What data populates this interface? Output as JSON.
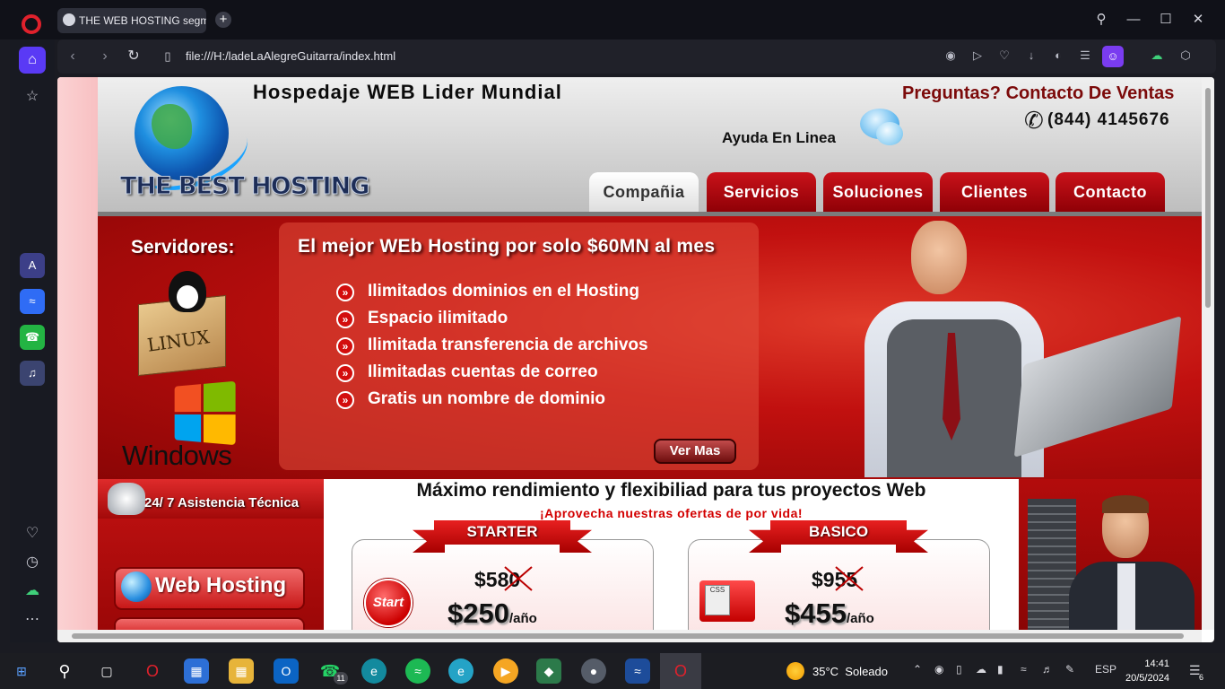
{
  "browser": {
    "tab_title": "THE WEB HOSTING segmé",
    "url": "file:///H:/ladeLaAlegreGuitarra/index.html",
    "colors": {
      "accent": "#7a3cf0",
      "chrome": "#101118"
    }
  },
  "header": {
    "tagline": "Hospedaje WEB Lider Mundial",
    "logo_text": "THE BEST HOSTING",
    "contact_prompt": "Preguntas? Contacto De Ventas",
    "phone": "(844) 4145676",
    "help_text": "Ayuda En Linea"
  },
  "nav": {
    "tabs": [
      {
        "label": "Compañia",
        "active": true
      },
      {
        "label": "Servicios"
      },
      {
        "label": "Soluciones"
      },
      {
        "label": "Clientes"
      },
      {
        "label": "Contacto"
      }
    ]
  },
  "banner": {
    "servers_title": "Servidores:",
    "linux_label": "LINUX",
    "windows_label": "Windows",
    "offer_title": "El mejor WEb Hosting por solo $60MN al mes",
    "features": [
      "Ilimitados dominios en el Hosting",
      "Espacio ilimitado",
      "Ilimitada transferencia de archivos",
      "Ilimitadas cuentas de correo",
      "Gratis un nombre de dominio"
    ],
    "more_button": "Ver Mas",
    "bullet_glyph": "»"
  },
  "sidebar_left": {
    "support_text": "24/ 7 Asistencia Técnica",
    "web_hosting_button": "Web Hosting"
  },
  "plans": {
    "title": "Máximo rendimiento y flexibiliad para tus proyectos Web",
    "subtitle": "¡Aprovecha nuestras ofertas de por vida!",
    "items": [
      {
        "name": "STARTER",
        "old_price": "$580",
        "new_price": "$250",
        "per": "/año",
        "badge": "Start"
      },
      {
        "name": "BASICO",
        "old_price": "$955",
        "new_price": "$455",
        "per": "/año",
        "badge": "CSS"
      }
    ]
  },
  "taskbar": {
    "weather_temp": "35°C",
    "weather_desc": "Soleado",
    "language": "ESP",
    "time": "14:41",
    "date": "20/5/2024",
    "whatsapp_badge": "11",
    "notification_count": "6"
  }
}
